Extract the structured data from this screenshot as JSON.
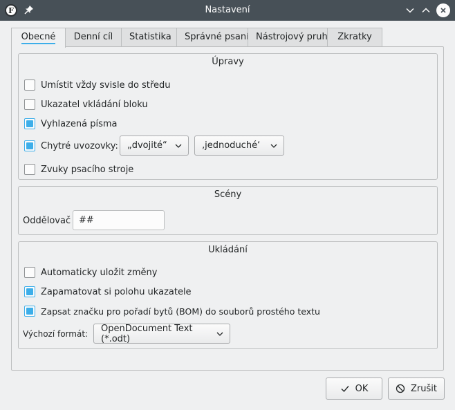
{
  "window": {
    "title": "Nastavení"
  },
  "tabs": [
    {
      "label": "Obecné",
      "active": true
    },
    {
      "label": "Denní cíl",
      "active": false
    },
    {
      "label": "Statistika",
      "active": false
    },
    {
      "label": "Správné psaní",
      "active": false
    },
    {
      "label": "Nástrojový pruh",
      "active": false
    },
    {
      "label": "Zkratky",
      "active": false
    }
  ],
  "upravy": {
    "title": "Úpravy",
    "center_vertically": {
      "label": "Umístit vždy svisle do středu",
      "checked": false
    },
    "block_cursor": {
      "label": "Ukazatel vkládání bloku",
      "checked": false
    },
    "smooth_fonts": {
      "label": "Vyhlazená písma",
      "checked": true
    },
    "smart_quotes": {
      "label": "Chytré uvozovky:",
      "checked": true,
      "double_value": "„dvojité“",
      "single_value": "‚jednoduché‘"
    },
    "typewriter_sounds": {
      "label": "Zvuky psacího stroje",
      "checked": false
    }
  },
  "sceny": {
    "title": "Scény",
    "separator_label": "Oddělovač",
    "separator_value": "##"
  },
  "ukladani": {
    "title": "Ukládání",
    "autosave": {
      "label": "Automaticky uložit změny",
      "checked": false
    },
    "remember_cursor": {
      "label": "Zapamatovat si polohu ukazatele",
      "checked": true
    },
    "write_bom": {
      "label": "Zapsat značku pro pořadí bytů (BOM) do souborů prostého textu",
      "checked": true
    },
    "default_format_label": "Výchozí formát:",
    "default_format_value": "OpenDocument Text (*.odt)"
  },
  "buttons": {
    "ok": "OK",
    "cancel": "Zrušit"
  },
  "colors": {
    "accent": "#3daee9",
    "titlebar": "#475057"
  }
}
